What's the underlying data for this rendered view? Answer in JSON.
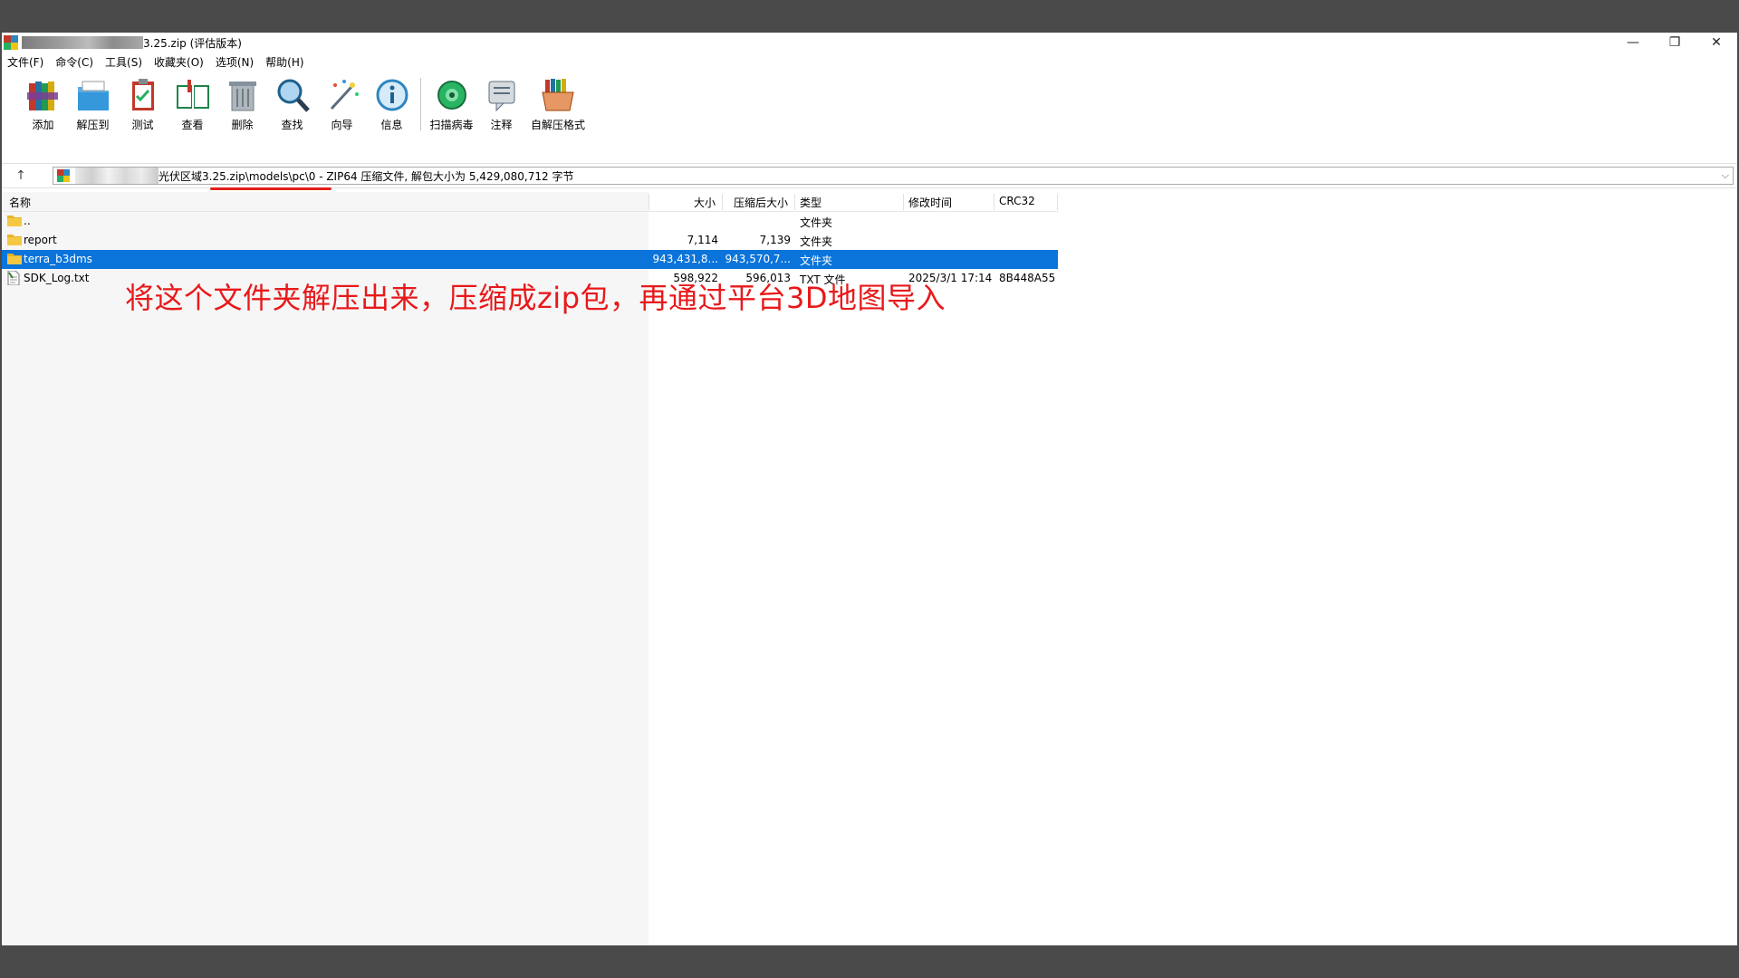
{
  "window": {
    "title": "3.25.zip (评估版本)",
    "controls": {
      "minimize": "—",
      "maximize": "❐",
      "close": "✕"
    }
  },
  "menu": [
    "文件(F)",
    "命令(C)",
    "工具(S)",
    "收藏夹(O)",
    "选项(N)",
    "帮助(H)"
  ],
  "toolbar": [
    {
      "label": "添加",
      "icon": "add-books-icon"
    },
    {
      "label": "解压到",
      "icon": "extract-folder-icon"
    },
    {
      "label": "测试",
      "icon": "test-clipboard-icon"
    },
    {
      "label": "查看",
      "icon": "view-book-icon"
    },
    {
      "label": "删除",
      "icon": "trash-icon"
    },
    {
      "label": "查找",
      "icon": "magnifier-icon"
    },
    {
      "label": "向导",
      "icon": "wizard-wand-icon"
    },
    {
      "label": "信息",
      "icon": "info-icon"
    },
    {
      "label": "扫描病毒",
      "icon": "virus-scan-icon"
    },
    {
      "label": "注释",
      "icon": "comment-icon"
    },
    {
      "label": "自解压格式",
      "icon": "sfx-box-icon"
    }
  ],
  "address": {
    "path": "光伏区域3.25.zip\\models\\pc\\0 - ZIP64 压缩文件, 解包大小为 5,429,080,712 字节"
  },
  "columns": [
    "名称",
    "大小",
    "压缩后大小",
    "类型",
    "修改时间",
    "CRC32"
  ],
  "rows": [
    {
      "name": "..",
      "size": "",
      "packed": "",
      "type": "文件夹",
      "modified": "",
      "crc": "",
      "kind": "folder",
      "selected": false
    },
    {
      "name": "report",
      "size": "7,114",
      "packed": "7,139",
      "type": "文件夹",
      "modified": "",
      "crc": "",
      "kind": "folder",
      "selected": false
    },
    {
      "name": "terra_b3dms",
      "size": "943,431,8...",
      "packed": "943,570,7...",
      "type": "文件夹",
      "modified": "",
      "crc": "",
      "kind": "folder",
      "selected": true
    },
    {
      "name": "SDK_Log.txt",
      "size": "598,922",
      "packed": "596,013",
      "type": "TXT 文件",
      "modified": "2025/3/1 17:14",
      "crc": "8B448A55",
      "kind": "file",
      "selected": false
    }
  ],
  "annotation": "将这个文件夹解压出来，压缩成zip包，再通过平台3D地图导入",
  "colors": {
    "selection": "#0a74da",
    "annotation": "#e8191b",
    "desktop": "#4a4a4a"
  }
}
